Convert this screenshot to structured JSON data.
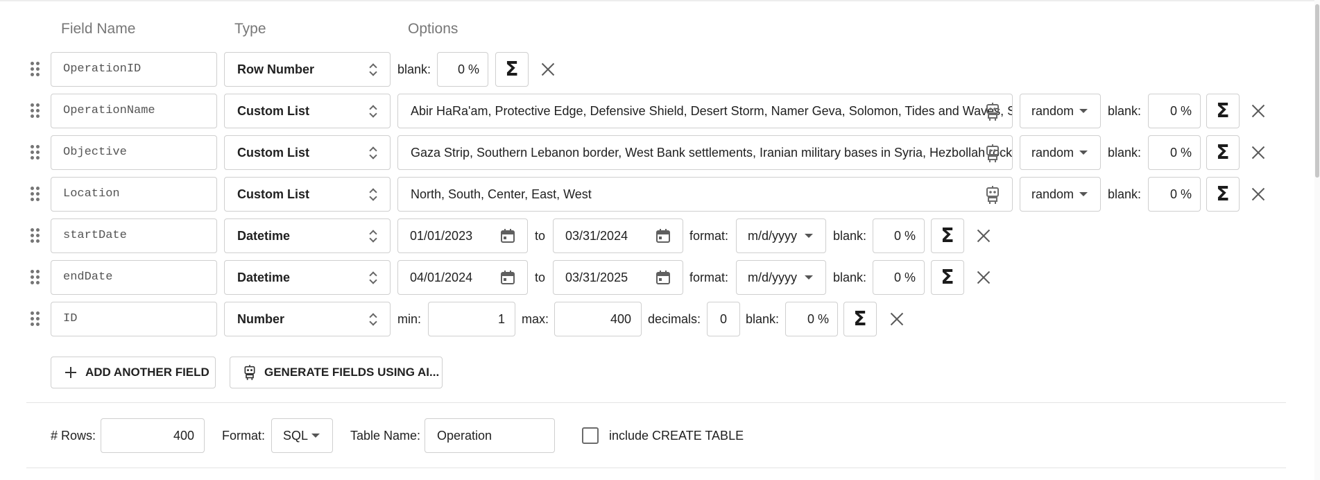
{
  "headers": {
    "field_name": "Field Name",
    "type": "Type",
    "options": "Options"
  },
  "fields": [
    {
      "name": "OperationID",
      "type": "Row Number",
      "blank_label": "blank:",
      "blank": "0 %"
    },
    {
      "name": "OperationName",
      "type": "Custom List",
      "values": "Abir HaRa'am, Protective Edge, Defensive Shield, Desert Storm, Namer Geva, Solomon, Tides and Waves, Sinai",
      "order": "random",
      "blank_label": "blank:",
      "blank": "0 %"
    },
    {
      "name": "Objective",
      "type": "Custom List",
      "values": "Gaza Strip, Southern Lebanon border, West Bank settlements, Iranian military bases in Syria, Hezbollah rocket sites",
      "order": "random",
      "blank_label": "blank:",
      "blank": "0 %"
    },
    {
      "name": "Location",
      "type": "Custom List",
      "values": "North, South, Center, East, West",
      "order": "random",
      "blank_label": "blank:",
      "blank": "0 %"
    },
    {
      "name": "startDate",
      "type": "Datetime",
      "from": "01/01/2023",
      "to_label": "to",
      "to": "03/31/2024",
      "format_label": "format:",
      "format": "m/d/yyyy",
      "blank_label": "blank:",
      "blank": "0 %"
    },
    {
      "name": "endDate",
      "type": "Datetime",
      "from": "04/01/2024",
      "to_label": "to",
      "to": "03/31/2025",
      "format_label": "format:",
      "format": "m/d/yyyy",
      "blank_label": "blank:",
      "blank": "0 %"
    },
    {
      "name": "ID",
      "type": "Number",
      "min_label": "min:",
      "min": "1",
      "max_label": "max:",
      "max": "400",
      "decimals_label": "decimals:",
      "decimals": "0",
      "blank_label": "blank:",
      "blank": "0 %"
    }
  ],
  "actions": {
    "add_field": "ADD ANOTHER FIELD",
    "generate_ai": "GENERATE FIELDS USING AI..."
  },
  "sigma_symbol": "Σ",
  "footer": {
    "rows_label": "# Rows:",
    "rows": "400",
    "format_label": "Format:",
    "format": "SQL",
    "table_label": "Table Name:",
    "table_name": "Operation",
    "create_table_label": "include CREATE TABLE",
    "create_table_checked": false
  },
  "icons": [
    "drag-handle-icon",
    "up-down-icon",
    "robot-icon",
    "calendar-icon",
    "sigma-icon",
    "close-icon",
    "plus-icon",
    "dropdown-caret-icon"
  ]
}
